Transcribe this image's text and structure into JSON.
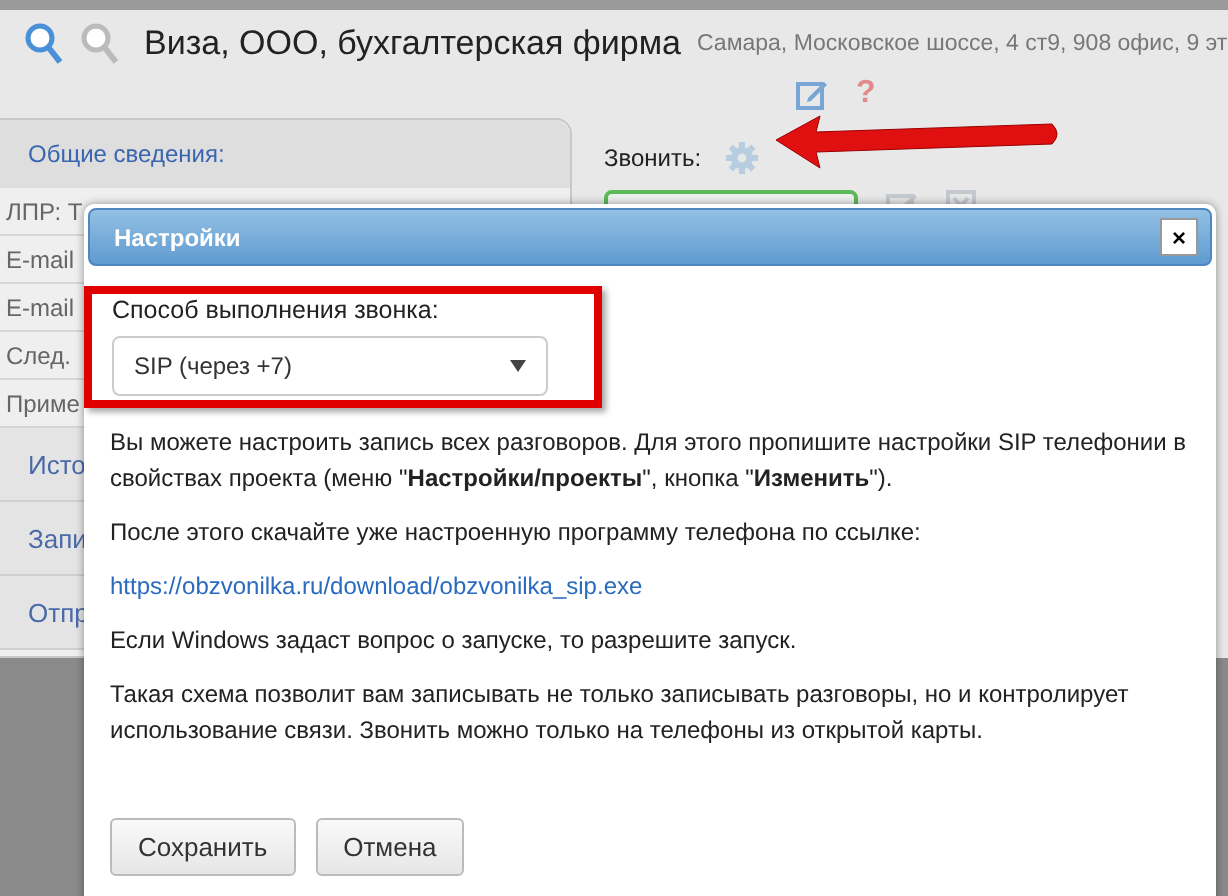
{
  "app": {
    "title": "Виза, ООО, бухгалтерская фирма",
    "address": "Самара, Московское шоссе, 4 ст9, 908 офис, 9 эт",
    "help": "?",
    "left_panel": {
      "heading": "Общие сведения:",
      "rows": [
        "ЛПР: Т",
        "E-mail",
        "E-mail",
        "След.",
        "Приме"
      ],
      "sections": [
        "Исто",
        "Запи",
        "Отпр"
      ]
    },
    "call_label": "Звонить:"
  },
  "dialog": {
    "title": "Настройки",
    "close": "×",
    "field_label": "Способ выполнения звонка:",
    "select_value": "SIP (через +7)",
    "content": [
      {
        "kind": "text",
        "text": "Вы можете настроить запись всех разговоров. Для этого пропишите настройки SIP телефонии в свойствах проекта (меню \"**Настройки/проекты**\", кнопка \"**Изменить**\")."
      },
      {
        "kind": "text",
        "text": "После этого скачайте уже настроенную программу телефона по ссылке:"
      },
      {
        "kind": "link",
        "text": "https://obzvonilka.ru/download/obzvonilka_sip.exe"
      },
      {
        "kind": "text",
        "text": "Если Windows задаст вопрос о запуске, то разрешите запуск."
      },
      {
        "kind": "text",
        "text": "Такая схема позволит вам записывать не только записывать разговоры, но и контролирует использование связи. Звонить можно только на телефоны из открытой карты."
      }
    ],
    "buttons": [
      "Сохранить",
      "Отмена"
    ]
  }
}
